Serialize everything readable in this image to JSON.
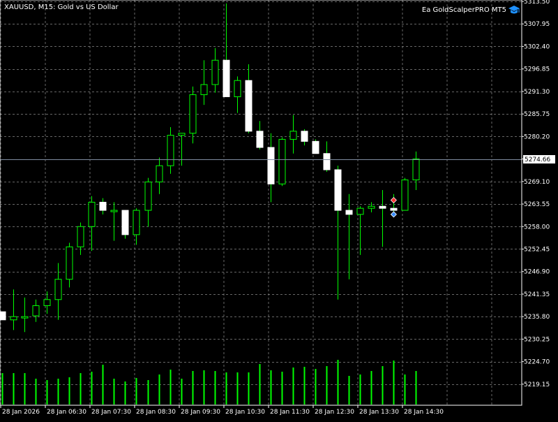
{
  "header": {
    "symbol_title": "XAUUSD, M15:  Gold vs US Dollar",
    "ea_name": "Ea GoldScalperPRO MT5",
    "ea_icon": "graduation-cap-icon"
  },
  "current_price_label": "5274.66",
  "colors": {
    "background": "#000000",
    "grid": "#8a8a8a",
    "bull_body": "#000000",
    "bull_outline": "#00ff00",
    "bear_body": "#ffffff",
    "bear_outline": "#ffffff",
    "wick": "#00ff00",
    "volume": "#00ff00",
    "axis_text": "#ffffff",
    "price_line": "#7f8ca0"
  },
  "chart_data": {
    "type": "candlestick",
    "symbol": "XAUUSD",
    "timeframe": "M15",
    "current_price": 5274.66,
    "ylim": [
      5214.3,
      5313.5
    ],
    "y_ticks": [
      5313.5,
      5307.95,
      5302.4,
      5296.85,
      5291.3,
      5285.75,
      5280.2,
      5274.65,
      5269.1,
      5263.55,
      5258.0,
      5252.45,
      5246.9,
      5241.35,
      5235.8,
      5230.25,
      5224.7,
      5219.15
    ],
    "y_tick_labels": [
      "5313.50",
      "5307.95",
      "5302.40",
      "5296.85",
      "5291.30",
      "5285.75",
      "5280.20",
      "5274.65",
      "5269.10",
      "5263.55",
      "5258.00",
      "5252.45",
      "5246.90",
      "5241.35",
      "5235.80",
      "5230.25",
      "5224.70",
      "5219.15"
    ],
    "x_tick_labels": [
      "28 Jan 2026",
      "28 Jan 06:30",
      "28 Jan 07:30",
      "28 Jan 08:30",
      "28 Jan 09:30",
      "28 Jan 10:30",
      "28 Jan 11:30",
      "28 Jan 12:30",
      "28 Jan 13:30",
      "28 Jan 14:30"
    ],
    "candles": [
      {
        "o": 5237.0,
        "h": 5237.0,
        "l": 5235.0,
        "c": 5235.0
      },
      {
        "o": 5235.0,
        "h": 5242.5,
        "l": 5232.5,
        "c": 5235.8
      },
      {
        "o": 5235.5,
        "h": 5240.5,
        "l": 5232.0,
        "c": 5235.8
      },
      {
        "o": 5236.0,
        "h": 5240.0,
        "l": 5234.5,
        "c": 5238.5
      },
      {
        "o": 5238.5,
        "h": 5242.0,
        "l": 5236.5,
        "c": 5240.0
      },
      {
        "o": 5240.0,
        "h": 5249.0,
        "l": 5235.0,
        "c": 5245.0
      },
      {
        "o": 5245.0,
        "h": 5254.0,
        "l": 5243.0,
        "c": 5253.0
      },
      {
        "o": 5253.0,
        "h": 5259.0,
        "l": 5251.0,
        "c": 5258.0
      },
      {
        "o": 5258.0,
        "h": 5265.5,
        "l": 5252.0,
        "c": 5264.0
      },
      {
        "o": 5264.0,
        "h": 5265.0,
        "l": 5261.0,
        "c": 5262.0
      },
      {
        "o": 5262.0,
        "h": 5264.0,
        "l": 5254.5,
        "c": 5262.0
      },
      {
        "o": 5262.0,
        "h": 5262.0,
        "l": 5255.0,
        "c": 5256.0
      },
      {
        "o": 5256.0,
        "h": 5262.5,
        "l": 5253.5,
        "c": 5262.0
      },
      {
        "o": 5262.0,
        "h": 5270.0,
        "l": 5258.0,
        "c": 5269.0
      },
      {
        "o": 5269.0,
        "h": 5275.0,
        "l": 5266.0,
        "c": 5273.0
      },
      {
        "o": 5273.0,
        "h": 5282.5,
        "l": 5271.0,
        "c": 5280.5
      },
      {
        "o": 5280.5,
        "h": 5281.0,
        "l": 5273.0,
        "c": 5281.0
      },
      {
        "o": 5281.0,
        "h": 5292.5,
        "l": 5278.5,
        "c": 5290.5
      },
      {
        "o": 5290.5,
        "h": 5299.0,
        "l": 5288.0,
        "c": 5293.0
      },
      {
        "o": 5293.0,
        "h": 5302.0,
        "l": 5291.0,
        "c": 5299.0
      },
      {
        "o": 5299.0,
        "h": 5313.0,
        "l": 5290.0,
        "c": 5290.0
      },
      {
        "o": 5290.0,
        "h": 5295.0,
        "l": 5286.0,
        "c": 5294.0
      },
      {
        "o": 5294.0,
        "h": 5298.0,
        "l": 5281.0,
        "c": 5281.5
      },
      {
        "o": 5281.5,
        "h": 5284.0,
        "l": 5277.0,
        "c": 5277.5
      },
      {
        "o": 5277.5,
        "h": 5281.0,
        "l": 5264.0,
        "c": 5268.5
      },
      {
        "o": 5268.5,
        "h": 5280.0,
        "l": 5268.0,
        "c": 5279.5
      },
      {
        "o": 5279.5,
        "h": 5285.5,
        "l": 5276.0,
        "c": 5281.5
      },
      {
        "o": 5281.5,
        "h": 5282.0,
        "l": 5278.0,
        "c": 5279.0
      },
      {
        "o": 5279.0,
        "h": 5279.5,
        "l": 5276.0,
        "c": 5276.0
      },
      {
        "o": 5276.0,
        "h": 5279.0,
        "l": 5271.5,
        "c": 5272.0
      },
      {
        "o": 5272.0,
        "h": 5273.0,
        "l": 5240.0,
        "c": 5262.0
      },
      {
        "o": 5262.0,
        "h": 5266.0,
        "l": 5245.0,
        "c": 5261.0
      },
      {
        "o": 5261.0,
        "h": 5263.0,
        "l": 5251.0,
        "c": 5262.5
      },
      {
        "o": 5262.5,
        "h": 5264.0,
        "l": 5261.5,
        "c": 5263.0
      },
      {
        "o": 5263.0,
        "h": 5267.0,
        "l": 5253.0,
        "c": 5262.5
      },
      {
        "o": 5262.5,
        "h": 5266.0,
        "l": 5261.0,
        "c": 5262.0
      },
      {
        "o": 5262.0,
        "h": 5270.0,
        "l": 5262.0,
        "c": 5269.5
      },
      {
        "o": 5269.5,
        "h": 5276.5,
        "l": 5267.0,
        "c": 5274.66
      }
    ],
    "volumes": [
      0.45,
      0.45,
      0.45,
      0.37,
      0.35,
      0.37,
      0.39,
      0.45,
      0.47,
      0.57,
      0.37,
      0.33,
      0.38,
      0.35,
      0.43,
      0.5,
      0.37,
      0.48,
      0.49,
      0.48,
      0.46,
      0.46,
      0.46,
      0.58,
      0.49,
      0.47,
      0.53,
      0.54,
      0.51,
      0.55,
      0.64,
      0.41,
      0.43,
      0.48,
      0.55,
      0.63,
      0.43,
      0.48
    ],
    "trade_markers": [
      {
        "type": "sell",
        "candle": 35,
        "price": 5264.5,
        "color": "#ff3030"
      },
      {
        "type": "buy",
        "candle": 35,
        "price": 5261.0,
        "color": "#3a8dff"
      }
    ]
  }
}
